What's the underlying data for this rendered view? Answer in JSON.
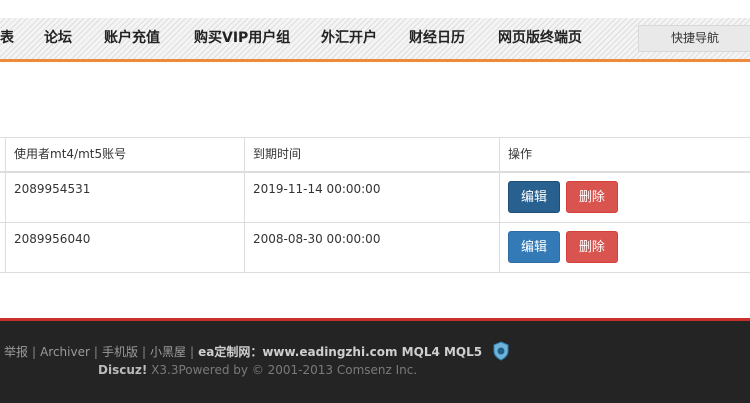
{
  "nav": {
    "items": [
      {
        "key": "partial",
        "label": "表"
      },
      {
        "key": "forum",
        "label": "论坛"
      },
      {
        "key": "recharge",
        "label": "账户充值"
      },
      {
        "key": "vip",
        "label": "购买VIP用户组"
      },
      {
        "key": "forex",
        "label": "外汇开户"
      },
      {
        "key": "calendar",
        "label": "财经日历"
      },
      {
        "key": "web",
        "label": "网页版终端页"
      }
    ],
    "quick_nav": "快捷导航",
    "accent_color": "#ef8a3a"
  },
  "table": {
    "headers": [
      "",
      "使用者mt4/mt5账号",
      "到期时间",
      "操作"
    ],
    "rows": [
      {
        "account": "2089954531",
        "expiry": "2019-11-14 00:00:00",
        "edit": "编辑",
        "delete": "删除"
      },
      {
        "account": "2089956040",
        "expiry": "2008-08-30 00:00:00",
        "edit": "编辑",
        "delete": "删除"
      }
    ]
  },
  "footer": {
    "links": [
      "举报",
      "Archiver",
      "手机版",
      "小黑屋"
    ],
    "site_label": "ea定制网：www.eadingzhi.com MQL4 MQL5",
    "badge_icon": "shield-check-icon",
    "powered_brand": "Discuz!",
    "powered_text": " X3.3Powered by © 2001-2013 Comsenz Inc."
  }
}
